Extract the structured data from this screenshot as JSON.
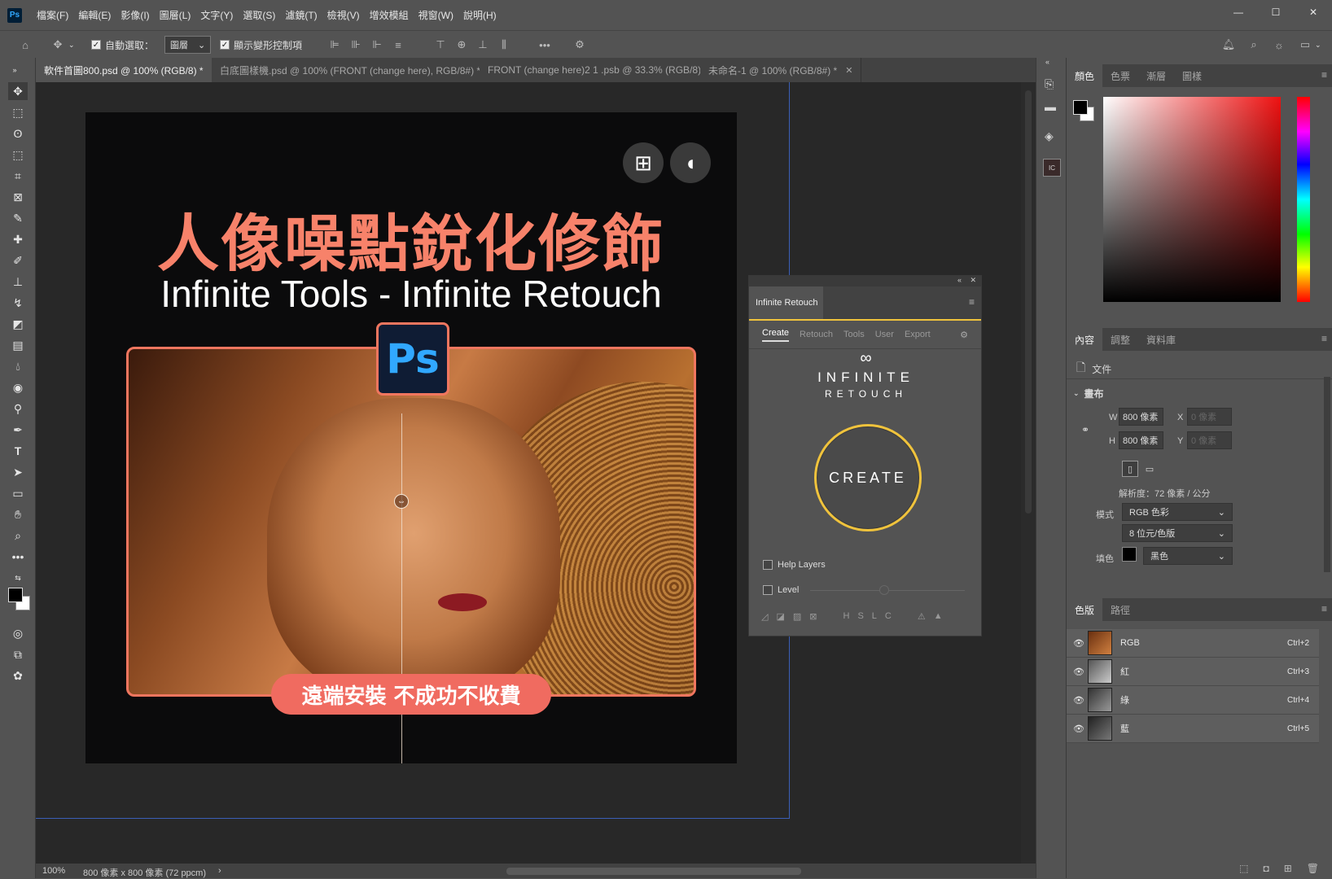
{
  "menubar": {
    "app_logo": "Ps",
    "items": [
      "檔案(F)",
      "編輯(E)",
      "影像(I)",
      "圖層(L)",
      "文字(Y)",
      "選取(S)",
      "濾鏡(T)",
      "檢視(V)",
      "增效模組",
      "視窗(W)",
      "說明(H)"
    ]
  },
  "options": {
    "auto_select_label": "自動選取：",
    "auto_select_target": "圖層",
    "show_transform_label": "顯示變形控制項",
    "more": "•••"
  },
  "tabs": [
    {
      "label": "軟件首圖800.psd @ 100% (RGB/8) *",
      "active": true
    },
    {
      "label": "白底圖樣機.psd @ 100% (FRONT (change here), RGB/8#) *",
      "active": false
    },
    {
      "label": "FRONT (change here)2 1 .psb @ 33.3% (RGB/8)",
      "active": false
    },
    {
      "label": "未命名-1 @ 100% (RGB/8#) *",
      "active": false
    }
  ],
  "artboard": {
    "title_cn": "人像噪點銳化修飾",
    "title_en": "Infinite Tools - Infinite Retouch",
    "ps_logo": "Ps",
    "banner": "遠端安裝 不成功不收費",
    "windows_icon": "⊞",
    "apple_icon": "◖"
  },
  "infinite_retouch": {
    "panel_title": "Infinite Retouch",
    "tabs": [
      "Create",
      "Retouch",
      "Tools",
      "User",
      "Export"
    ],
    "logo_symbol": "∞",
    "logo_line1": "INFINITE",
    "logo_line2": "RETOUCH",
    "create_label": "CREATE",
    "help_layers": "Help Layers",
    "level": "Level",
    "bottom_letters": [
      "H",
      "S",
      "L",
      "C"
    ]
  },
  "color_panel": {
    "tabs": [
      "顏色",
      "色票",
      "漸層",
      "圖樣"
    ]
  },
  "properties_panel": {
    "tabs": [
      "內容",
      "調整",
      "資料庫"
    ],
    "doc_label": "文件",
    "section": "畫布",
    "w_label": "W",
    "w_value": "800 像素",
    "h_label": "H",
    "h_value": "800 像素",
    "x_label": "X",
    "x_placeholder": "0 像素",
    "y_label": "Y",
    "y_placeholder": "0 像素",
    "resolution": "解析度：72 像素 / 公分",
    "mode_label": "模式",
    "mode_value": "RGB 色彩",
    "depth_value": "8 位元/色版",
    "fill_label": "填色",
    "fill_value": "黑色"
  },
  "channels_panel": {
    "tabs": [
      "色版",
      "路徑"
    ],
    "rows": [
      {
        "name": "RGB",
        "shortcut": "Ctrl+2"
      },
      {
        "name": "紅",
        "shortcut": "Ctrl+3"
      },
      {
        "name": "綠",
        "shortcut": "Ctrl+4"
      },
      {
        "name": "藍",
        "shortcut": "Ctrl+5"
      }
    ]
  },
  "status": {
    "zoom": "100%",
    "doc_info": "800 像素 x 800 像素 (72 ppcm)"
  }
}
